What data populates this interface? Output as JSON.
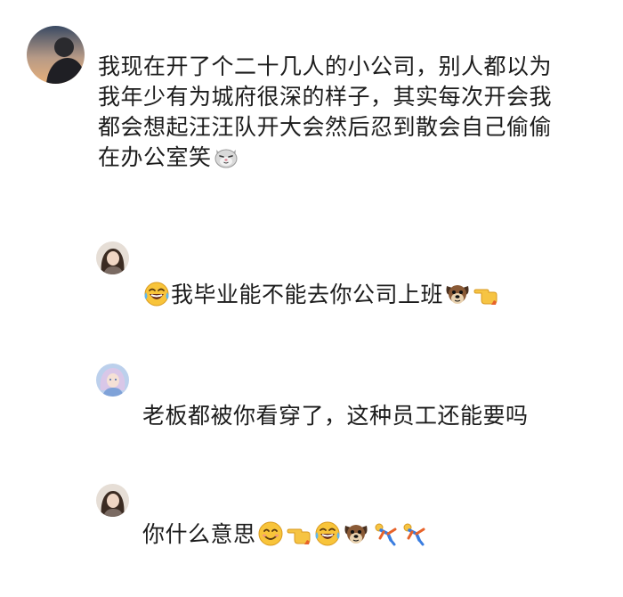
{
  "comments": [
    {
      "avatar": "avatar-photo",
      "lines": [
        "我现在开了个二十几人的小公司，别人都以为",
        "我年少有为城府很深的样子，其实每次开会我",
        "都会想起汪汪队开大会然后忍到散会自己偷偷",
        "在办公室笑"
      ],
      "trailing_emojis": [
        "cat-face-icon"
      ]
    },
    {
      "avatar": "avatar-photo",
      "leading_emojis": [
        "laughing-tears-icon"
      ],
      "text": "我毕业能不能去你公司上班",
      "trailing_emojis": [
        "dog-face-icon",
        "pointing-hand-icon"
      ]
    },
    {
      "avatar": "avatar-photo",
      "text": "老板都被你看穿了，这种员工还能要吗"
    },
    {
      "avatar": "avatar-photo",
      "text": "你什么意思",
      "trailing_emojis": [
        "smiling-face-icon",
        "pointing-hand-icon",
        "laughing-tears-icon",
        "dog-face-icon",
        "dancing-figure-icon",
        "dancing-figure-icon"
      ]
    }
  ]
}
